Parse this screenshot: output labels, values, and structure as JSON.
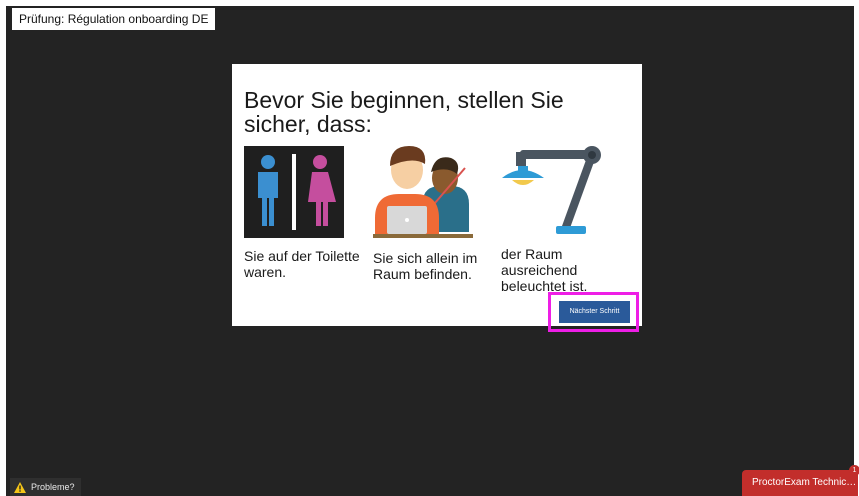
{
  "exam": {
    "tab_label": "Prüfung: Régulation onboarding DE"
  },
  "dialog": {
    "title": "Bevor Sie beginnen, stellen Sie sicher, dass:",
    "requirements": [
      {
        "icon": "restroom-icon",
        "lines": [
          "Sie auf der Toilette",
          "waren."
        ]
      },
      {
        "icon": "alone-in-room-icon",
        "lines": [
          "Sie sich allein im",
          "Raum befinden."
        ]
      },
      {
        "icon": "desk-lamp-icon",
        "lines": [
          "der Raum",
          "ausreichend",
          "beleuchtet ist."
        ]
      }
    ],
    "next_button": "Nächster Schritt"
  },
  "footer": {
    "problems_label": "Probleme?",
    "support_label": "ProctorExam Technic…",
    "support_badge": "1"
  },
  "colors": {
    "background": "#232323",
    "button": "#2a5a9a",
    "highlight": "#ee1ee6",
    "support": "#c22e2b"
  }
}
